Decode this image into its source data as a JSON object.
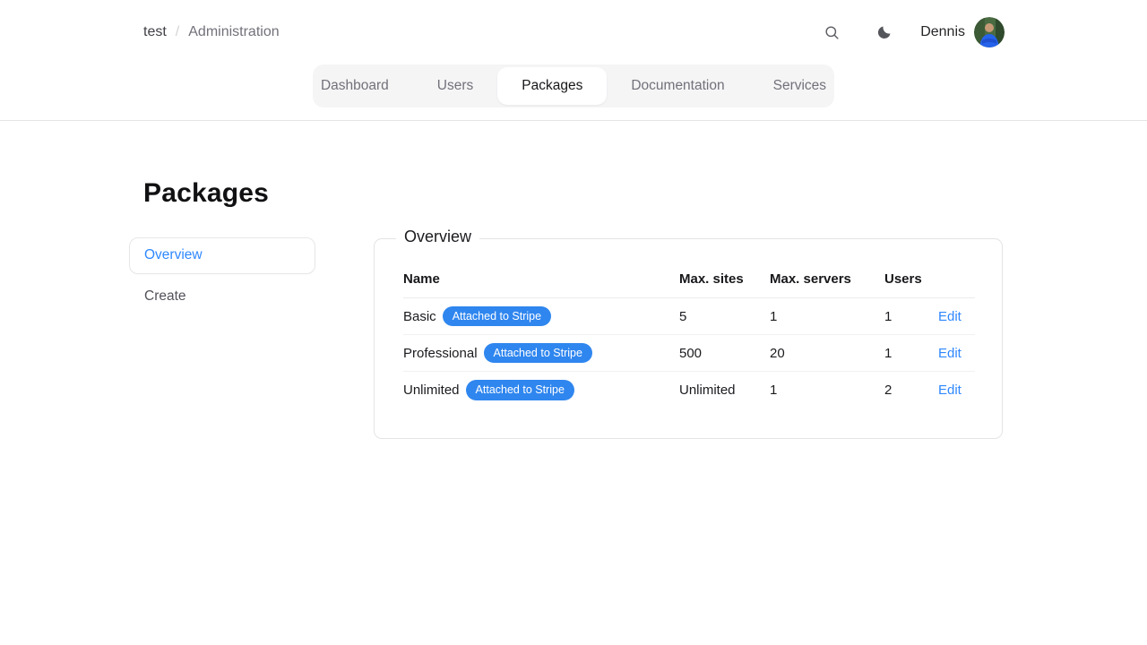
{
  "breadcrumb": {
    "root": "test",
    "separator": "/",
    "current": "Administration"
  },
  "header": {
    "user_name": "Dennis",
    "icons": [
      "search-icon",
      "moon-icon",
      "avatar"
    ]
  },
  "tabs": [
    {
      "label": "Dashboard",
      "active": false
    },
    {
      "label": "Users",
      "active": false
    },
    {
      "label": "Packages",
      "active": true
    },
    {
      "label": "Documentation",
      "active": false
    },
    {
      "label": "Services",
      "active": false
    }
  ],
  "page": {
    "title": "Packages"
  },
  "sidebar": {
    "items": [
      {
        "label": "Overview",
        "active": true
      },
      {
        "label": "Create",
        "active": false
      }
    ]
  },
  "panel": {
    "legend": "Overview",
    "table": {
      "columns": [
        "Name",
        "Max. sites",
        "Max. servers",
        "Users"
      ],
      "rows": [
        {
          "name": "Basic",
          "badge": "Attached to Stripe",
          "max_sites": "5",
          "max_servers": "1",
          "users": "1",
          "action": "Edit"
        },
        {
          "name": "Professional",
          "badge": "Attached to Stripe",
          "max_sites": "500",
          "max_servers": "20",
          "users": "1",
          "action": "Edit"
        },
        {
          "name": "Unlimited",
          "badge": "Attached to Stripe",
          "max_sites": "Unlimited",
          "max_servers": "1",
          "users": "2",
          "action": "Edit"
        }
      ]
    }
  },
  "colors": {
    "link_blue": "#2f88ff",
    "badge_blue": "#2f86ef",
    "tab_bg": "#f5f5f6",
    "border": "#e4e4e7"
  }
}
